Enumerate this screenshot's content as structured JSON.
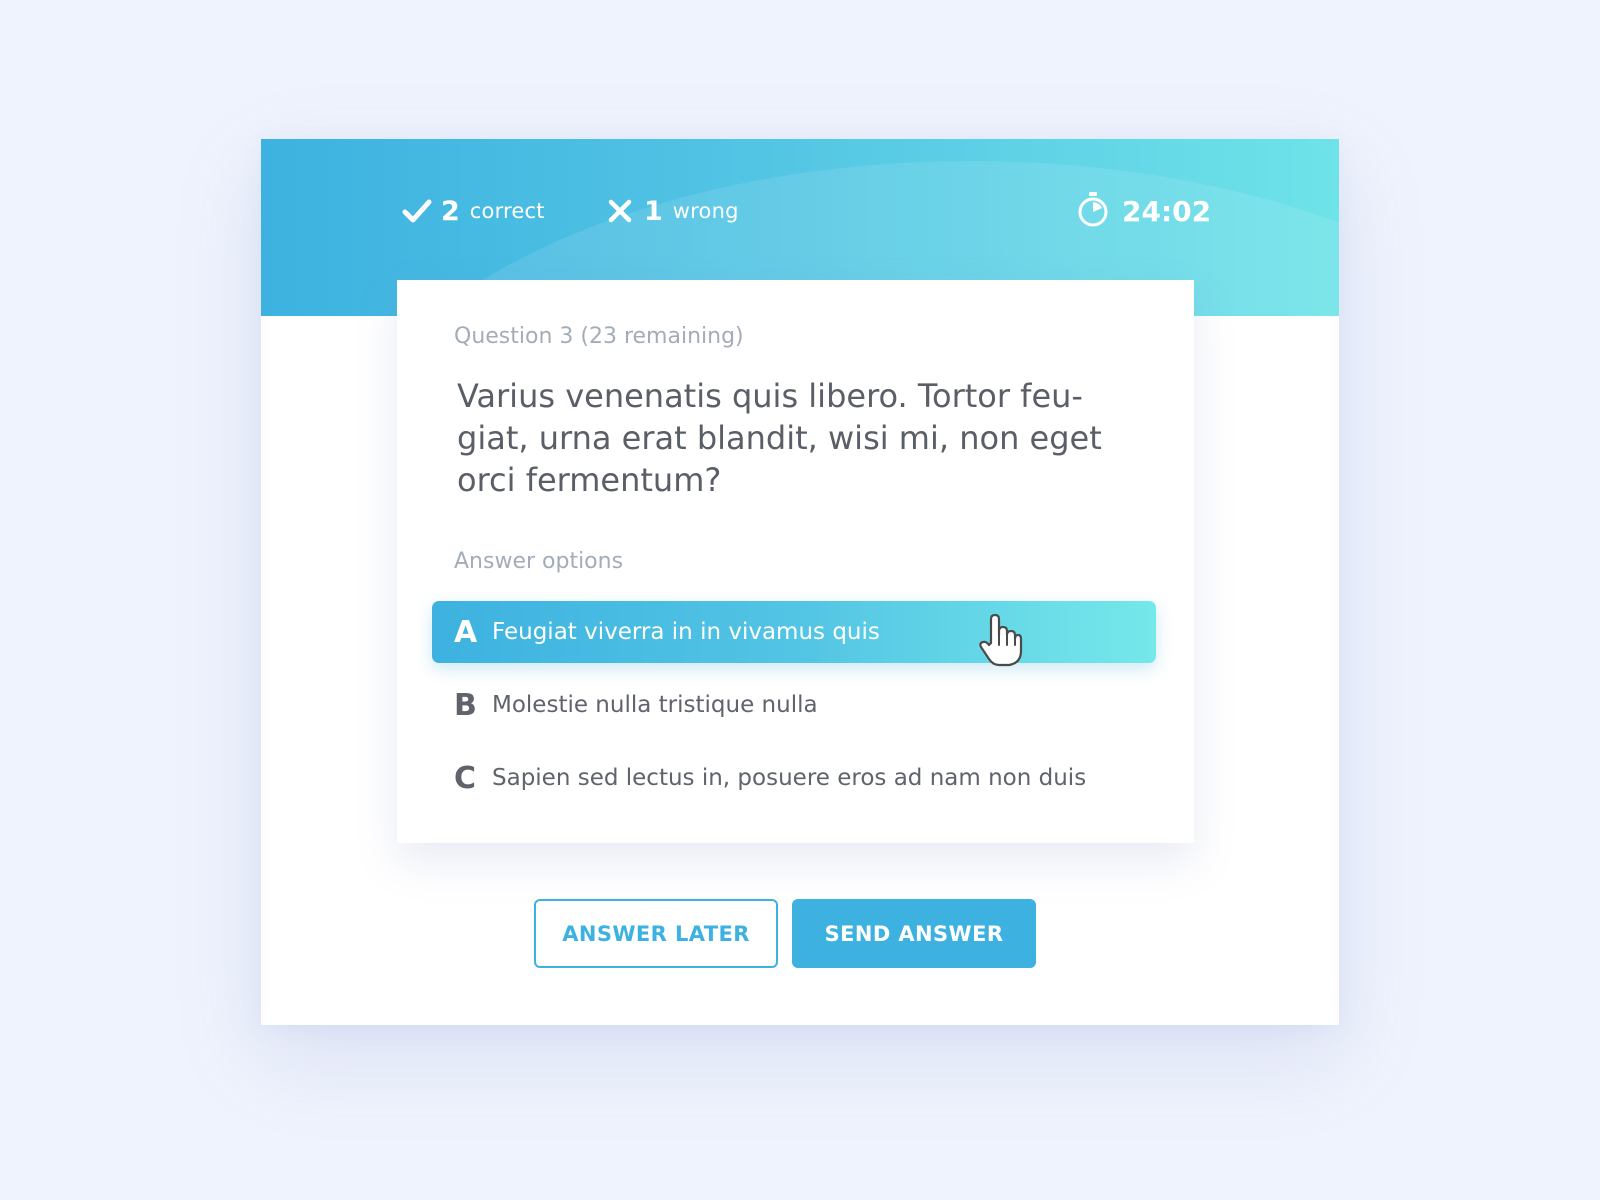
{
  "score": {
    "correct_count": "2",
    "correct_label": "correct",
    "wrong_count": "1",
    "wrong_label": "wrong"
  },
  "timer": {
    "value": "24:02",
    "icon": "stopwatch-icon"
  },
  "question": {
    "meta": "Question 3 (23 remaining)",
    "text": "Varius venenatis quis libero. Tortor feu-giat, urna erat blandit, wisi mi, non eget orci fermentum?"
  },
  "answers": {
    "label": "Answer options",
    "options": [
      {
        "letter": "A",
        "text": "Feugiat viverra in in vivamus quis",
        "selected": true
      },
      {
        "letter": "B",
        "text": "Molestie nulla tristique nulla",
        "selected": false
      },
      {
        "letter": "C",
        "text": "Sapien sed lectus in, posuere eros ad nam non duis",
        "selected": false
      }
    ]
  },
  "actions": {
    "later_label": "ANSWER LATER",
    "send_label": "SEND ANSWER"
  },
  "colors": {
    "accent": "#3db2e0",
    "accent_light": "#6ee3e8",
    "background": "#eff3fd"
  }
}
